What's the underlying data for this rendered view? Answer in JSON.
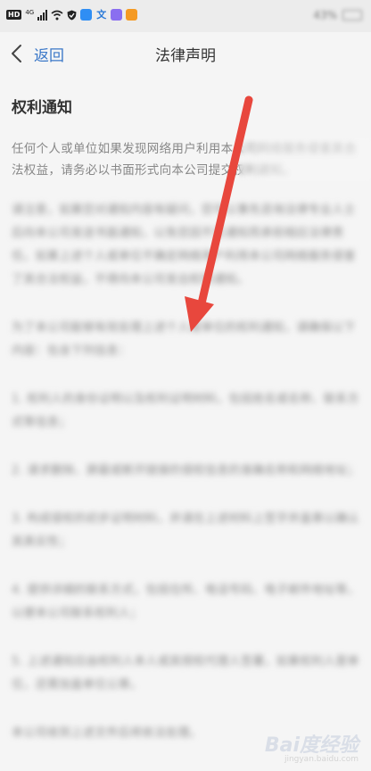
{
  "status_bar": {
    "hd": "HD",
    "network": "4G",
    "battery": "43%",
    "app_icon_colors": [
      "#2f8ef4",
      "#3bb7f0",
      "#8a6ef0",
      "#f59a23"
    ]
  },
  "nav": {
    "back_label": "返回",
    "title": "法律声明"
  },
  "content": {
    "section_title": "权利通知",
    "intro": "任何个人或单位如果发现网络用户利用本公司网络服务侵害其合法权益，请务必以书面形式向本公司提交权利通知。",
    "blurred_paragraphs": [
      "请注意，如果您对通知内容有疑问，您可以事先咨询法律专业人士后向本公司发送书面通知，以免您因不实通知而承担相应法律责任。如果上述个人或单位不确定网络用户利用本公司网络服务侵害了其合法权益，不得向本公司发出权利通知。",
      "为了本公司能够有效处理上述个人或单位的权利通知，请确保以下内容：包含下列信息：",
      "1. 权利人的身份证明以及权利证明材料，包括姓名或名称、联系方式等信息；",
      "2. 请求删除、屏蔽或断开链接的侵权信息的准确名称和网络地址；",
      "3. 构成侵权的初步证明材料，并请在上述材料上签字并盖章以确认其真实性；",
      "4. 提供详细的联系方式，包括住所、电话号码、电子邮件地址等，以便本公司联系权利人；",
      "5. 上述通知应由权利人本人或其授权代理人签署，如果权利人是单位，还需加盖单位公章。",
      "本公司收到上述文件后将依法处理。"
    ]
  },
  "watermark": {
    "logo": "Bai度经验",
    "url": "jingyan.baidu.com"
  },
  "colors": {
    "accent": "#3b78c8",
    "arrow": "#e8473d",
    "background": "#f5f5f5"
  }
}
